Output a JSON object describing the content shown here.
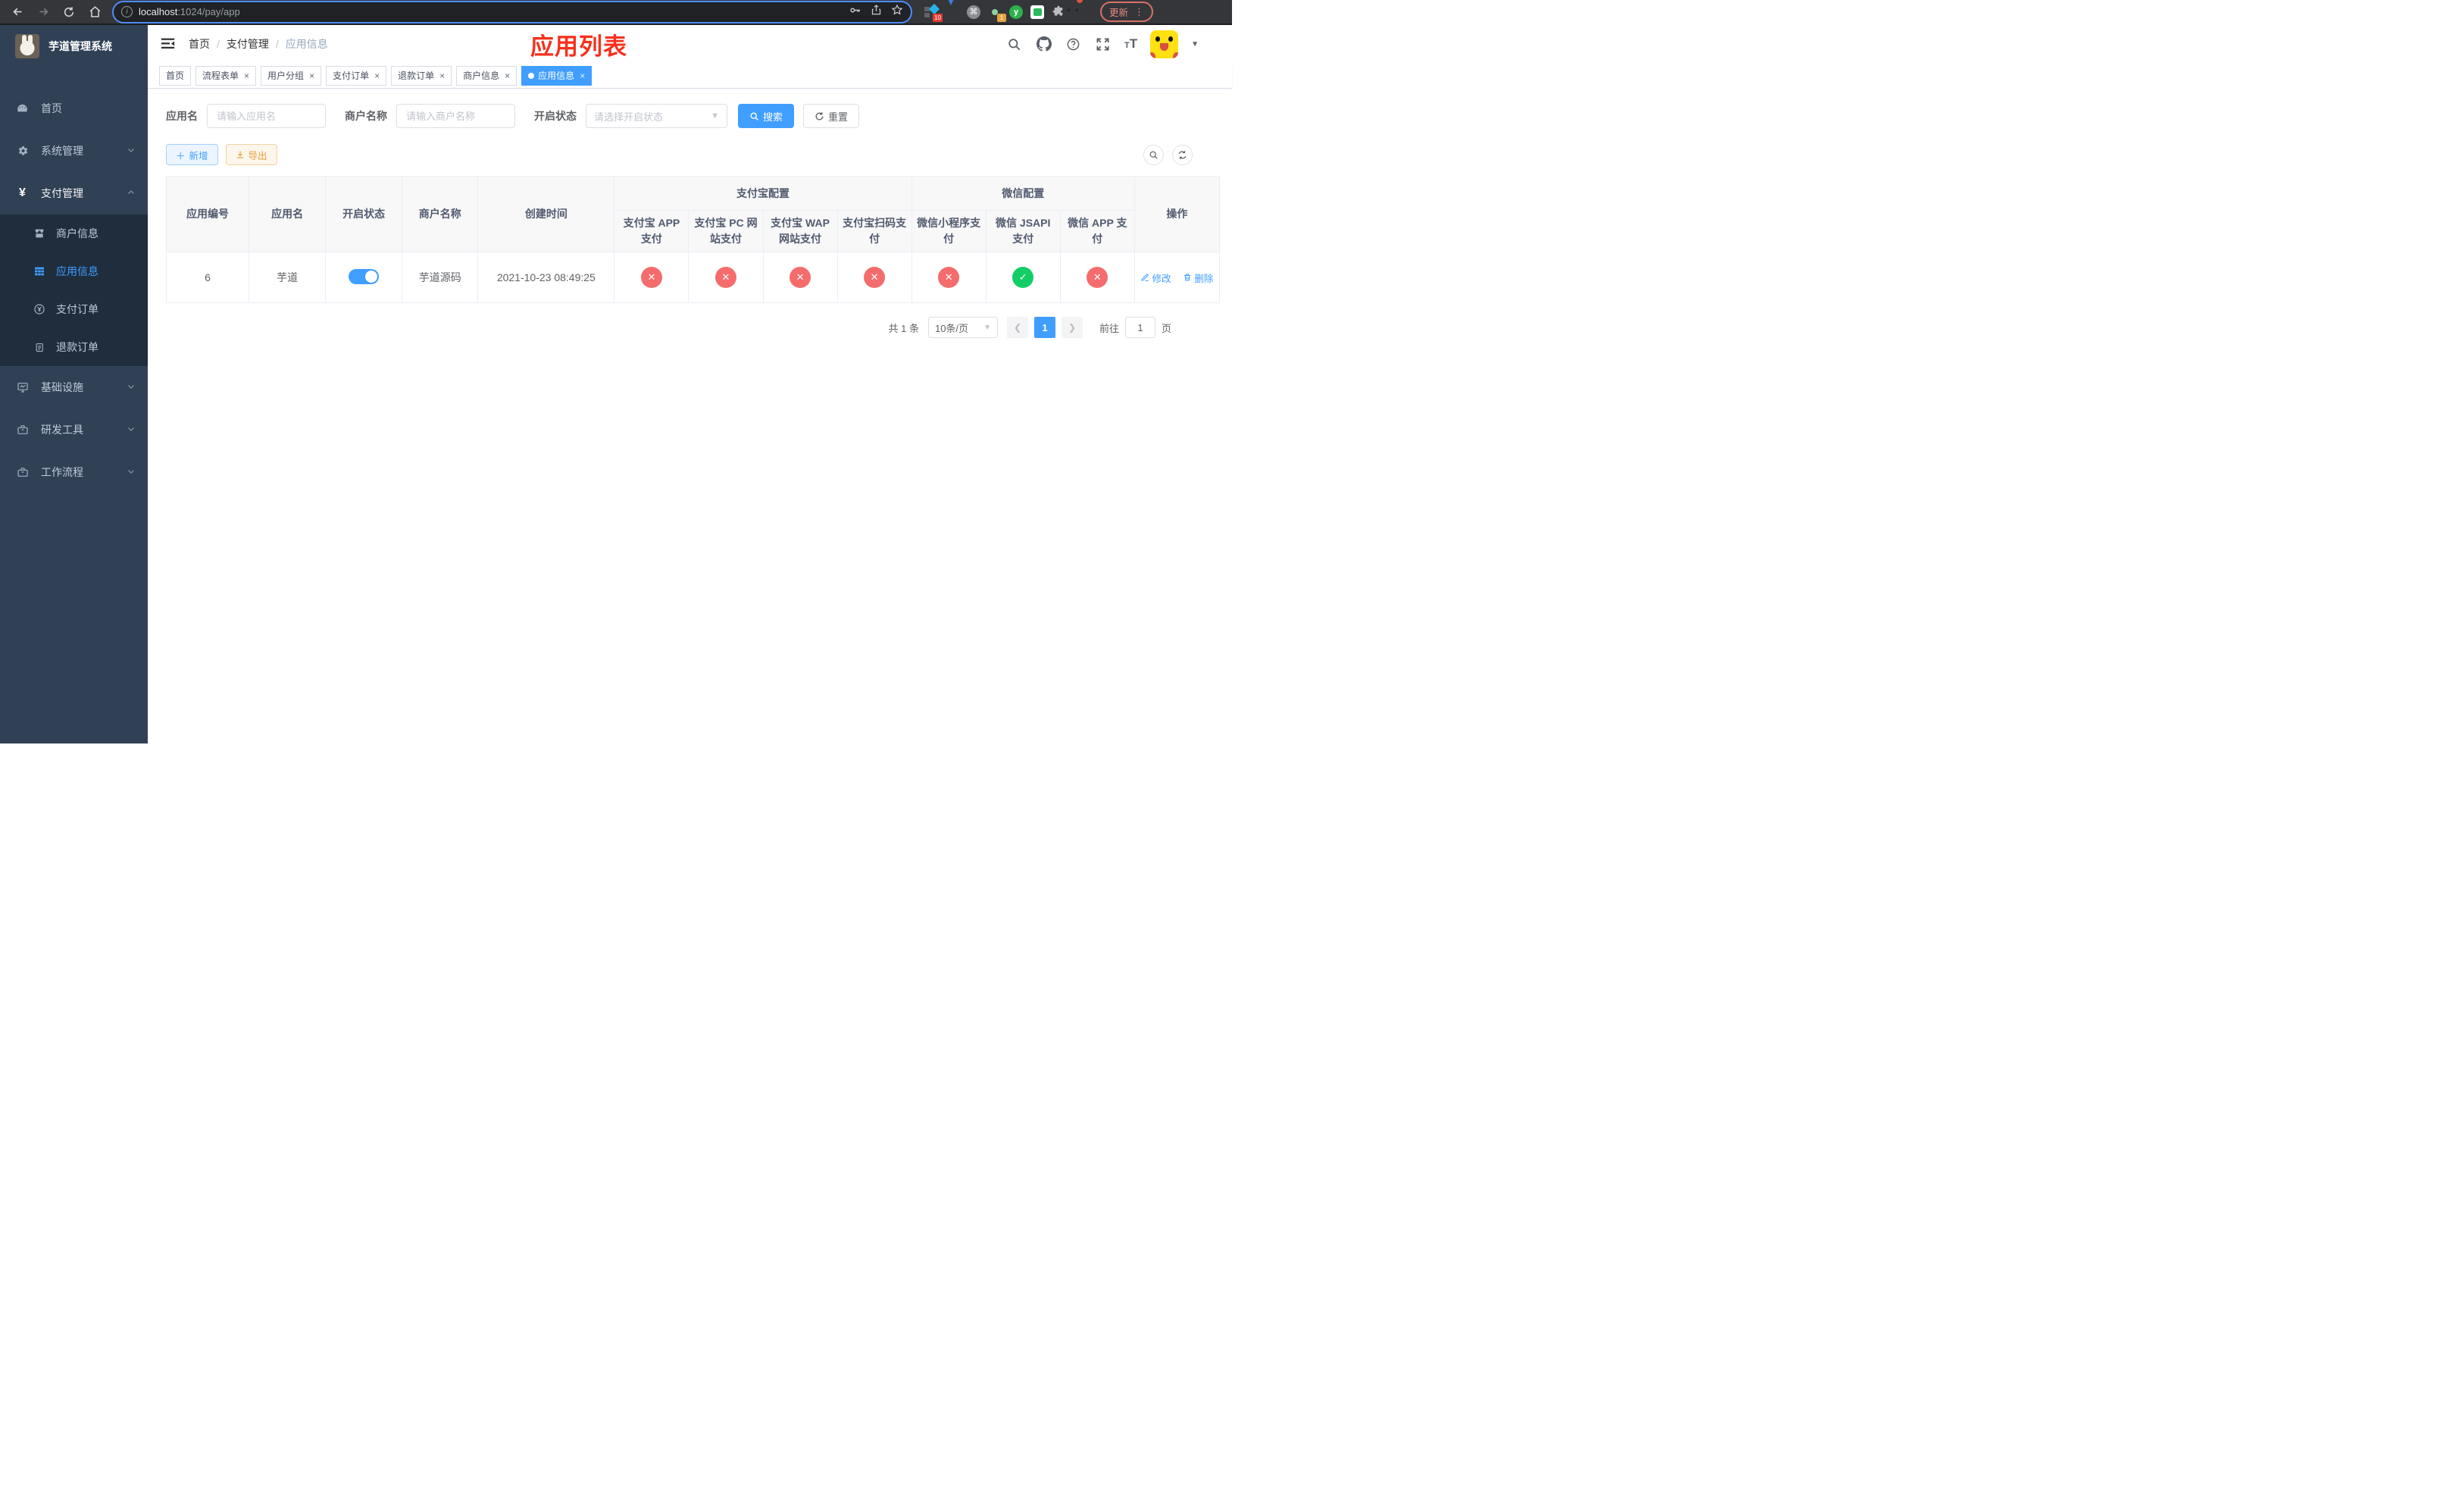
{
  "browser": {
    "url_host": "localhost",
    "url_rest": ":1024/pay/app",
    "ext_badge_pin": "10",
    "ext_badge_tab": "1",
    "ext_y_label": "y",
    "ext_cmd_glyph": "⌘",
    "update_label": "更新"
  },
  "sidebar": {
    "title": "芋道管理系统",
    "menu": [
      {
        "label": "首页"
      },
      {
        "label": "系统管理"
      },
      {
        "label": "支付管理"
      },
      {
        "label": "商户信息"
      },
      {
        "label": "应用信息"
      },
      {
        "label": "支付订单"
      },
      {
        "label": "退款订单"
      },
      {
        "label": "基础设施"
      },
      {
        "label": "研发工具"
      },
      {
        "label": "工作流程"
      }
    ]
  },
  "navbar": {
    "breadcrumb": [
      "首页",
      "支付管理",
      "应用信息"
    ],
    "separator": "/",
    "annotation": "应用列表",
    "annotation_color": "#f6301e"
  },
  "tabs": [
    {
      "label": "首页",
      "closable": false,
      "active": false
    },
    {
      "label": "流程表单",
      "closable": true,
      "active": false
    },
    {
      "label": "用户分组",
      "closable": true,
      "active": false
    },
    {
      "label": "支付订单",
      "closable": true,
      "active": false
    },
    {
      "label": "退款订单",
      "closable": true,
      "active": false
    },
    {
      "label": "商户信息",
      "closable": true,
      "active": false
    },
    {
      "label": "应用信息",
      "closable": true,
      "active": true
    }
  ],
  "filters": {
    "app_name_label": "应用名",
    "app_name_placeholder": "请输入应用名",
    "merchant_label": "商户名称",
    "merchant_placeholder": "请输入商户名称",
    "status_label": "开启状态",
    "status_placeholder": "请选择开启状态",
    "search_label": "搜索",
    "reset_label": "重置"
  },
  "toolbar": {
    "add_label": "新增",
    "export_label": "导出"
  },
  "table": {
    "group_alipay": "支付宝配置",
    "group_wechat": "微信配置",
    "col_id": "应用编号",
    "col_name": "应用名",
    "col_status": "开启状态",
    "col_merchant": "商户名称",
    "col_created": "创建时间",
    "col_op": "操作",
    "sub_columns": [
      "支付宝 APP 支付",
      "支付宝 PC 网站支付",
      "支付宝 WAP 网站支付",
      "支付宝扫码支付",
      "微信小程序支付",
      "微信 JSAPI 支付",
      "微信 APP 支付"
    ],
    "row": {
      "id": "6",
      "name": "芋道",
      "status_on": true,
      "merchant": "芋道源码",
      "created": "2021-10-23 08:49:25",
      "channels": [
        "x",
        "x",
        "x",
        "x",
        "x",
        "check",
        "x"
      ],
      "edit_label": "修改",
      "delete_label": "删除"
    }
  },
  "pagination": {
    "total": "共 1 条",
    "page_size": "10条/页",
    "current_page": "1",
    "goto_label": "前往",
    "goto_value": "1",
    "page_suffix": "页"
  },
  "colors": {
    "primary": "#409eff",
    "success_circle": "#13ce66",
    "danger_circle": "#f56c6c",
    "sidebar_bg": "#304156",
    "submenu_bg": "#1f2d3d",
    "annotation_red": "#f6301e"
  }
}
